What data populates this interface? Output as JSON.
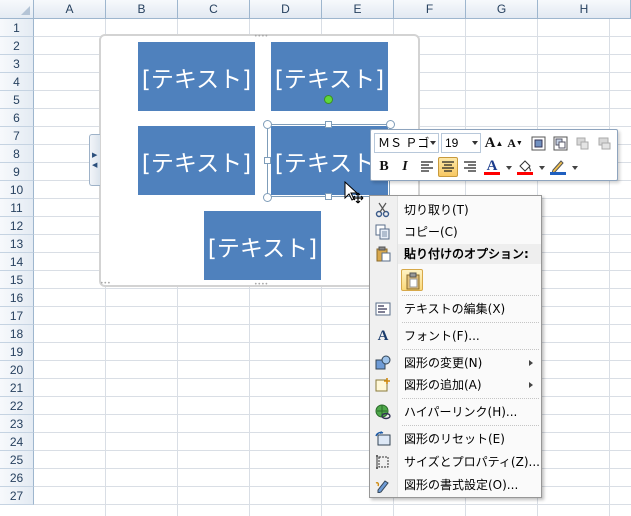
{
  "sheet": {
    "columns": [
      "A",
      "B",
      "C",
      "D",
      "E",
      "F",
      "G",
      "H"
    ],
    "rows": [
      "1",
      "2",
      "3",
      "4",
      "5",
      "6",
      "7",
      "8",
      "9",
      "10",
      "11",
      "12",
      "13",
      "14",
      "15",
      "16",
      "17",
      "18",
      "19",
      "20",
      "21",
      "22",
      "23",
      "24",
      "25",
      "26",
      "27"
    ]
  },
  "smartart": {
    "boxes": [
      "[テキスト]",
      "[テキスト]",
      "[テキスト]",
      "[テキスト]",
      "[テキスト]"
    ],
    "box_color": "#4f81bd"
  },
  "mini_toolbar": {
    "font_name": "ＭＳ Ｐゴシック",
    "font_name_display": "ＭＳ Ｐゴ",
    "font_size": "19",
    "bold": "B",
    "italic": "I",
    "font_color_glyph": "A",
    "font_color": "#ff0000",
    "fill_color": "#ff0000",
    "outline_color": "#1f5fbf"
  },
  "context_menu": {
    "items": [
      {
        "label": "切り取り(T)",
        "icon": "scissors-icon"
      },
      {
        "label": "コピー(C)",
        "icon": "copy-icon"
      },
      {
        "label": "貼り付けのオプション:",
        "icon": "paste-icon"
      },
      {
        "label": "テキストの編集(X)",
        "icon": "edit-text-icon"
      },
      {
        "label": "フォント(F)...",
        "icon": "font-icon"
      },
      {
        "label": "図形の変更(N)",
        "icon": "change-shape-icon"
      },
      {
        "label": "図形の追加(A)",
        "icon": "add-shape-icon"
      },
      {
        "label": "ハイパーリンク(H)...",
        "icon": "hyperlink-icon"
      },
      {
        "label": "図形のリセット(E)",
        "icon": "reset-shape-icon"
      },
      {
        "label": "サイズとプロパティ(Z)...",
        "icon": "size-properties-icon"
      },
      {
        "label": "図形の書式設定(O)...",
        "icon": "format-shape-icon"
      }
    ]
  }
}
